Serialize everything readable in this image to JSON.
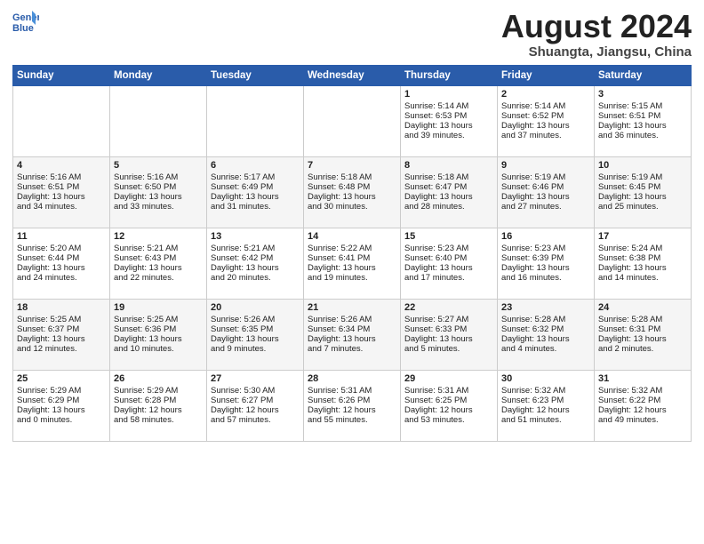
{
  "header": {
    "logo_line1": "General",
    "logo_line2": "Blue",
    "month_year": "August 2024",
    "location": "Shuangta, Jiangsu, China"
  },
  "days_of_week": [
    "Sunday",
    "Monday",
    "Tuesday",
    "Wednesday",
    "Thursday",
    "Friday",
    "Saturday"
  ],
  "weeks": [
    [
      {
        "day": "",
        "content": ""
      },
      {
        "day": "",
        "content": ""
      },
      {
        "day": "",
        "content": ""
      },
      {
        "day": "",
        "content": ""
      },
      {
        "day": "1",
        "content": "Sunrise: 5:14 AM\nSunset: 6:53 PM\nDaylight: 13 hours\nand 39 minutes."
      },
      {
        "day": "2",
        "content": "Sunrise: 5:14 AM\nSunset: 6:52 PM\nDaylight: 13 hours\nand 37 minutes."
      },
      {
        "day": "3",
        "content": "Sunrise: 5:15 AM\nSunset: 6:51 PM\nDaylight: 13 hours\nand 36 minutes."
      }
    ],
    [
      {
        "day": "4",
        "content": "Sunrise: 5:16 AM\nSunset: 6:51 PM\nDaylight: 13 hours\nand 34 minutes."
      },
      {
        "day": "5",
        "content": "Sunrise: 5:16 AM\nSunset: 6:50 PM\nDaylight: 13 hours\nand 33 minutes."
      },
      {
        "day": "6",
        "content": "Sunrise: 5:17 AM\nSunset: 6:49 PM\nDaylight: 13 hours\nand 31 minutes."
      },
      {
        "day": "7",
        "content": "Sunrise: 5:18 AM\nSunset: 6:48 PM\nDaylight: 13 hours\nand 30 minutes."
      },
      {
        "day": "8",
        "content": "Sunrise: 5:18 AM\nSunset: 6:47 PM\nDaylight: 13 hours\nand 28 minutes."
      },
      {
        "day": "9",
        "content": "Sunrise: 5:19 AM\nSunset: 6:46 PM\nDaylight: 13 hours\nand 27 minutes."
      },
      {
        "day": "10",
        "content": "Sunrise: 5:19 AM\nSunset: 6:45 PM\nDaylight: 13 hours\nand 25 minutes."
      }
    ],
    [
      {
        "day": "11",
        "content": "Sunrise: 5:20 AM\nSunset: 6:44 PM\nDaylight: 13 hours\nand 24 minutes."
      },
      {
        "day": "12",
        "content": "Sunrise: 5:21 AM\nSunset: 6:43 PM\nDaylight: 13 hours\nand 22 minutes."
      },
      {
        "day": "13",
        "content": "Sunrise: 5:21 AM\nSunset: 6:42 PM\nDaylight: 13 hours\nand 20 minutes."
      },
      {
        "day": "14",
        "content": "Sunrise: 5:22 AM\nSunset: 6:41 PM\nDaylight: 13 hours\nand 19 minutes."
      },
      {
        "day": "15",
        "content": "Sunrise: 5:23 AM\nSunset: 6:40 PM\nDaylight: 13 hours\nand 17 minutes."
      },
      {
        "day": "16",
        "content": "Sunrise: 5:23 AM\nSunset: 6:39 PM\nDaylight: 13 hours\nand 16 minutes."
      },
      {
        "day": "17",
        "content": "Sunrise: 5:24 AM\nSunset: 6:38 PM\nDaylight: 13 hours\nand 14 minutes."
      }
    ],
    [
      {
        "day": "18",
        "content": "Sunrise: 5:25 AM\nSunset: 6:37 PM\nDaylight: 13 hours\nand 12 minutes."
      },
      {
        "day": "19",
        "content": "Sunrise: 5:25 AM\nSunset: 6:36 PM\nDaylight: 13 hours\nand 10 minutes."
      },
      {
        "day": "20",
        "content": "Sunrise: 5:26 AM\nSunset: 6:35 PM\nDaylight: 13 hours\nand 9 minutes."
      },
      {
        "day": "21",
        "content": "Sunrise: 5:26 AM\nSunset: 6:34 PM\nDaylight: 13 hours\nand 7 minutes."
      },
      {
        "day": "22",
        "content": "Sunrise: 5:27 AM\nSunset: 6:33 PM\nDaylight: 13 hours\nand 5 minutes."
      },
      {
        "day": "23",
        "content": "Sunrise: 5:28 AM\nSunset: 6:32 PM\nDaylight: 13 hours\nand 4 minutes."
      },
      {
        "day": "24",
        "content": "Sunrise: 5:28 AM\nSunset: 6:31 PM\nDaylight: 13 hours\nand 2 minutes."
      }
    ],
    [
      {
        "day": "25",
        "content": "Sunrise: 5:29 AM\nSunset: 6:29 PM\nDaylight: 13 hours\nand 0 minutes."
      },
      {
        "day": "26",
        "content": "Sunrise: 5:29 AM\nSunset: 6:28 PM\nDaylight: 12 hours\nand 58 minutes."
      },
      {
        "day": "27",
        "content": "Sunrise: 5:30 AM\nSunset: 6:27 PM\nDaylight: 12 hours\nand 57 minutes."
      },
      {
        "day": "28",
        "content": "Sunrise: 5:31 AM\nSunset: 6:26 PM\nDaylight: 12 hours\nand 55 minutes."
      },
      {
        "day": "29",
        "content": "Sunrise: 5:31 AM\nSunset: 6:25 PM\nDaylight: 12 hours\nand 53 minutes."
      },
      {
        "day": "30",
        "content": "Sunrise: 5:32 AM\nSunset: 6:23 PM\nDaylight: 12 hours\nand 51 minutes."
      },
      {
        "day": "31",
        "content": "Sunrise: 5:32 AM\nSunset: 6:22 PM\nDaylight: 12 hours\nand 49 minutes."
      }
    ]
  ]
}
